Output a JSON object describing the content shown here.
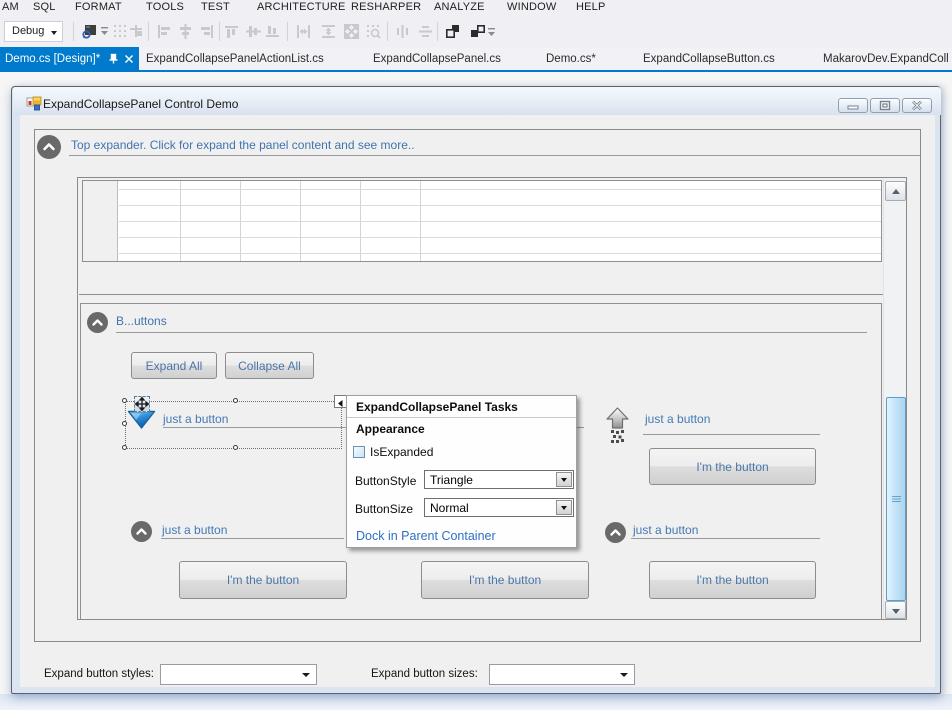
{
  "menu": {
    "items": [
      {
        "label": "AM"
      },
      {
        "label": "SQL"
      },
      {
        "label": "FORMAT"
      },
      {
        "label": "TOOLS"
      },
      {
        "label": "TEST"
      },
      {
        "label": "ARCHITECTURE"
      },
      {
        "label": "RESHARPER"
      },
      {
        "label": "ANALYZE"
      },
      {
        "label": "WINDOW"
      },
      {
        "label": "HELP"
      }
    ]
  },
  "toolbar": {
    "debug_label": "Debug",
    "icons": [
      "find-in-files-icon",
      "toolbar-overflow-icon",
      "show-grid-icon",
      "snap-to-grid-icon",
      "align-lefts-icon",
      "align-centers-icon",
      "align-rights-icon",
      "align-tops-icon",
      "align-middles-icon",
      "align-bottoms-icon",
      "make-same-width-icon",
      "make-same-height-icon",
      "make-same-size-icon",
      "size-to-grid-icon",
      "horizontal-spacing-icon",
      "vertical-spacing-icon",
      "bring-to-front-icon",
      "send-to-back-icon",
      "toolbar-overflow-icon"
    ]
  },
  "tabs": {
    "active": {
      "label": "Demo.cs [Design]*"
    },
    "items": [
      {
        "label": "ExpandCollapsePanelActionList.cs"
      },
      {
        "label": "ExpandCollapsePanel.cs"
      },
      {
        "label": "Demo.cs*"
      },
      {
        "label": "ExpandCollapseButton.cs"
      },
      {
        "label": "MakarovDev.ExpandColl"
      }
    ]
  },
  "designer": {
    "window_title": "ExpandCollapsePanel Control Demo",
    "top_expander": {
      "label": "Top expander. Click for expand the panel content and see more.."
    },
    "buttons_group": {
      "label": "B...uttons",
      "expand_all": "Expand All",
      "collapse_all": "Collapse All"
    },
    "expanders": {
      "selected": {
        "label": "just a button"
      },
      "right": {
        "label": "just a button",
        "button": "I'm the button"
      },
      "bottom_left": {
        "label": "just a button",
        "button": "I'm the button"
      },
      "bottom_middle": {
        "button": "I'm the button"
      },
      "bottom_right": {
        "label": "just a button",
        "button": "I'm the button"
      }
    },
    "smart_tag": {
      "title": "ExpandCollapsePanel Tasks",
      "section": "Appearance",
      "checkbox_label": "IsExpanded",
      "button_style_label": "ButtonStyle",
      "button_style_value": "Triangle",
      "button_size_label": "ButtonSize",
      "button_size_value": "Normal",
      "link": "Dock in Parent Container"
    },
    "footer": {
      "styles_label": "Expand button styles:",
      "sizes_label": "Expand button sizes:"
    }
  },
  "colors": {
    "accent": "#007acc",
    "expander_header_blue": "#3f74ae",
    "button_text_blue": "#4a76a8",
    "link_blue": "#2f6fc4",
    "scrollbar_thumb_blue": "#b9ddf4",
    "form_background": "#f0f0f0"
  }
}
